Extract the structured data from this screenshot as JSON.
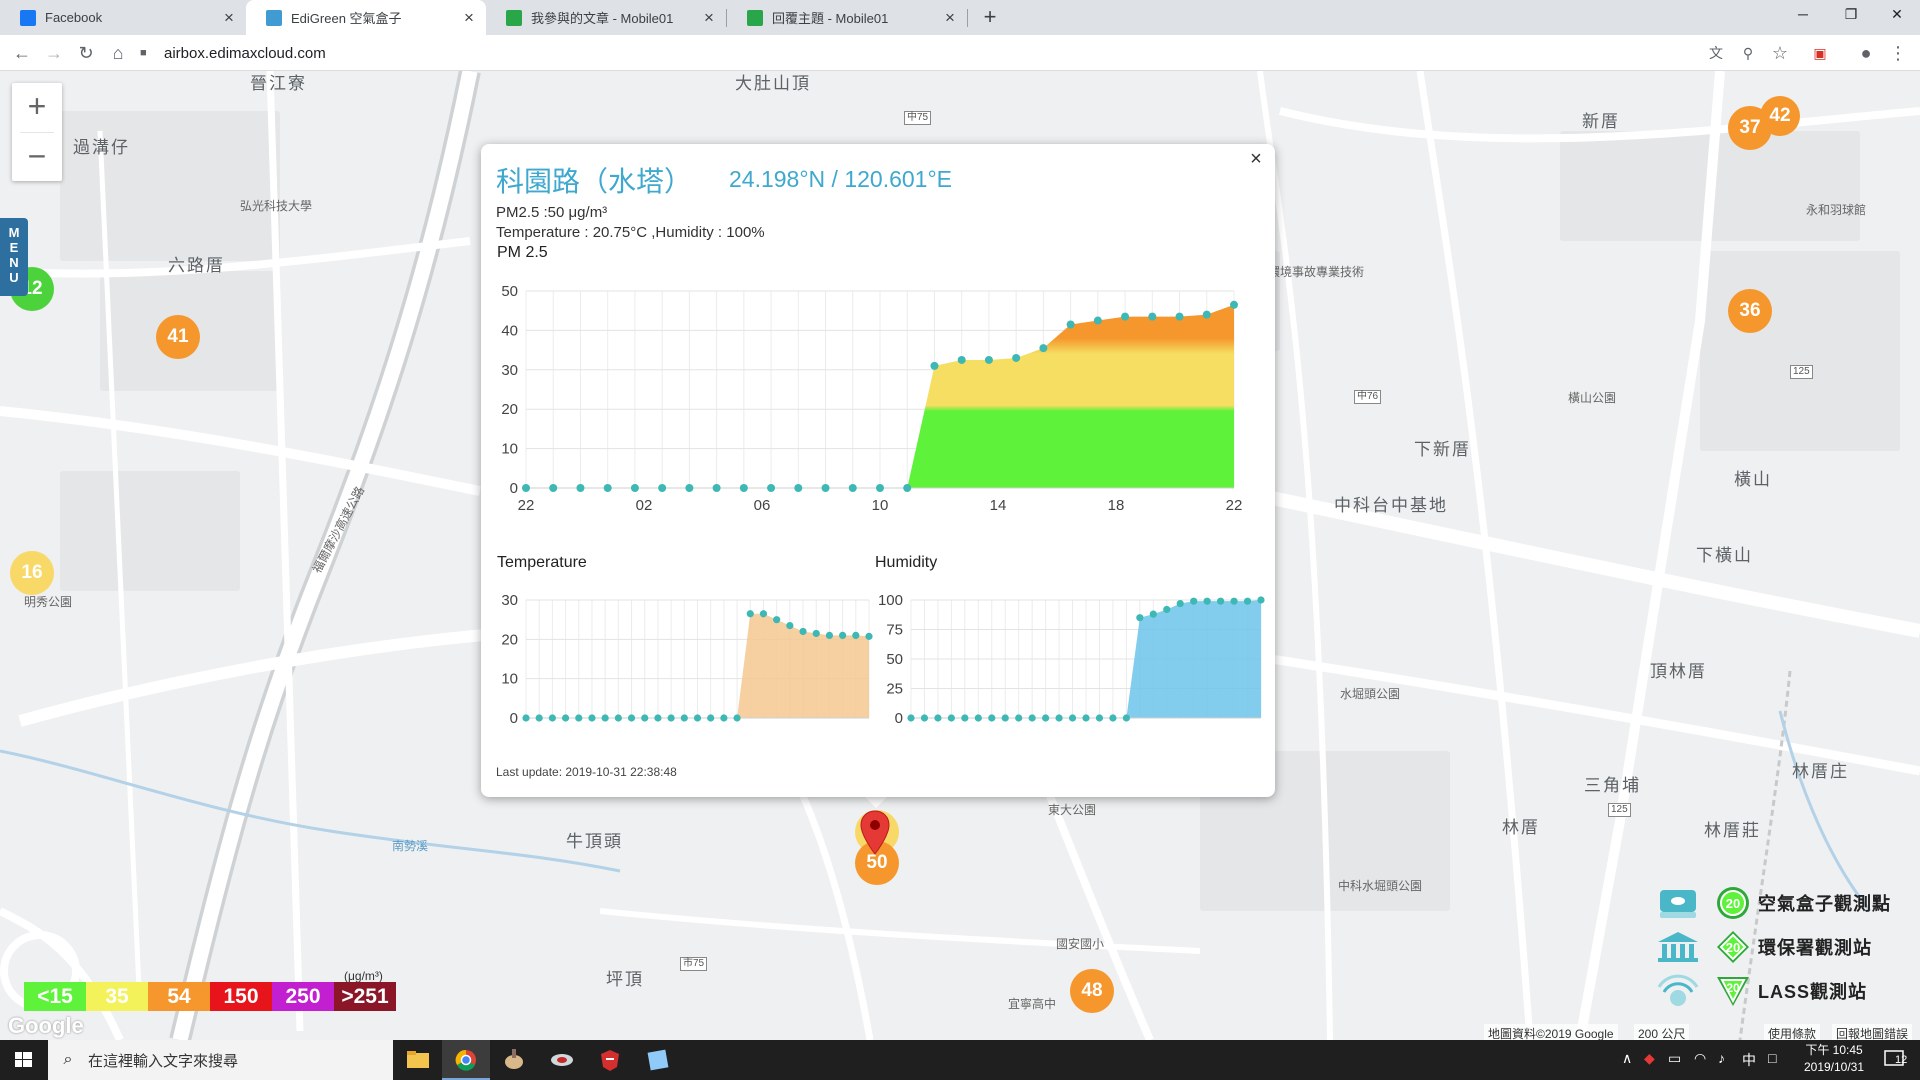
{
  "browser": {
    "tabs": [
      {
        "title": "Facebook",
        "favicon_color": "#1877f2",
        "active": false
      },
      {
        "title": "EdiGreen 空氣盒子",
        "favicon_color": "#3f9bd1",
        "active": true
      },
      {
        "title": "我參與的文章 - Mobile01",
        "favicon_color": "#2aa64a",
        "active": false
      },
      {
        "title": "回覆主題 - Mobile01",
        "favicon_color": "#2aa64a",
        "active": false
      }
    ],
    "new_tab": "+",
    "address": "airbox.edimaxcloud.com"
  },
  "map": {
    "zoom_in": "+",
    "zoom_out": "−",
    "menu_label": [
      "M",
      "E",
      "N",
      "U"
    ],
    "labels": {
      "l1": "晉江寮",
      "l2": "過溝仔",
      "l3": "大肚山頂",
      "l4": "新厝",
      "l5": "六路厝",
      "l6": "下新厝",
      "l7": "中科台中基地",
      "l8": "橫山",
      "l9": "下橫山",
      "l10": "頂林厝",
      "l11": "三角埔",
      "l12": "林厝",
      "l13": "林厝庄",
      "l14": "林厝莊",
      "l15": "牛頂頭",
      "l16": "坪頂",
      "l17": "東大公園",
      "l18": "明秀公園",
      "l19": "弘光科技大學",
      "l20": "台中環境事故專業技術小組",
      "l21": "橫山公園",
      "l22": "水堀頭公園",
      "l23": "中科水堀頭公園",
      "l24": "國安國小",
      "l25": "宜寧高中",
      "l26": "福爾摩沙高速公路",
      "l27": "南勢溪",
      "l28": "永和羽球館"
    },
    "markers": [
      {
        "value": "37"
      },
      {
        "value": "42"
      },
      {
        "value": "36"
      },
      {
        "value": "12"
      },
      {
        "value": "41"
      },
      {
        "value": "16"
      },
      {
        "value": "48"
      },
      {
        "value": "50"
      }
    ],
    "legend": {
      "unit": "(μg/m³)",
      "items": [
        {
          "label": "<15",
          "color": "#5ef23b"
        },
        {
          "label": "35",
          "color": "#f3f25b"
        },
        {
          "label": "54",
          "color": "#f5972c"
        },
        {
          "label": "150",
          "color": "#e8141c"
        },
        {
          "label": "250",
          "color": "#c21fd1"
        },
        {
          "label": ">251",
          "color": "#8a1628"
        }
      ]
    },
    "stations": [
      {
        "badge": "20",
        "label": "空氣盒子觀測點"
      },
      {
        "badge": "20",
        "label": "環保署觀測站"
      },
      {
        "badge": "20",
        "label": "LASS觀測站"
      }
    ],
    "google_logo": "Google",
    "attribution": {
      "data": "地圖資料©2019 Google",
      "scale": "200 公尺",
      "terms": "使用條款",
      "report": "回報地圖錯誤"
    }
  },
  "popup": {
    "title": "科園路（水塔）",
    "coords": "24.198°N / 120.601°E",
    "pm_line": "PM2.5 :50 μg/m³",
    "env_line": "Temperature : 20.75°C ,Humidity : 100%",
    "pm_heading": "PM 2.5",
    "temp_heading": "Temperature",
    "hum_heading": "Humidity",
    "last_update": "Last update: 2019-10-31 22:38:48",
    "close": "×"
  },
  "chart_data": [
    {
      "type": "area",
      "title": "PM 2.5",
      "xlabel": "",
      "ylabel": "",
      "x_tick_labels": [
        "22",
        "02",
        "06",
        "10",
        "14",
        "18",
        "22"
      ],
      "ylim": [
        0,
        50
      ],
      "yticks": [
        0,
        10,
        20,
        30,
        40,
        50
      ],
      "grid": true,
      "colors": {
        "green": "#5ef23b",
        "yellow": "#f6de62",
        "orange": "#f5972c",
        "marker": "#3db8b4"
      },
      "values": [
        0,
        0,
        0,
        0,
        0,
        0,
        0,
        0,
        0,
        0,
        0,
        0,
        0,
        0,
        0,
        31,
        32.5,
        32.5,
        33,
        35.5,
        41.5,
        42.5,
        43.5,
        43.5,
        43.5,
        44,
        46.5
      ]
    },
    {
      "type": "area",
      "title": "Temperature",
      "ylim": [
        0,
        30
      ],
      "yticks": [
        0,
        10,
        20,
        30
      ],
      "grid": true,
      "color": "#f5c88f",
      "values": [
        0,
        0,
        0,
        0,
        0,
        0,
        0,
        0,
        0,
        0,
        0,
        0,
        0,
        0,
        0,
        0,
        0,
        26.5,
        26.5,
        25,
        23.5,
        22,
        21.5,
        21,
        21,
        21,
        20.75
      ]
    },
    {
      "type": "area",
      "title": "Humidity",
      "ylim": [
        0,
        100
      ],
      "yticks": [
        0,
        25,
        50,
        75,
        100
      ],
      "grid": true,
      "color": "#6cc4ea",
      "values": [
        0,
        0,
        0,
        0,
        0,
        0,
        0,
        0,
        0,
        0,
        0,
        0,
        0,
        0,
        0,
        0,
        0,
        85,
        88,
        92,
        97,
        99,
        99,
        99,
        99,
        99,
        100
      ]
    }
  ],
  "taskbar": {
    "search_placeholder": "在這裡輸入文字來搜尋",
    "ime": "中",
    "time": "下午 10:45",
    "date": "2019/10/31",
    "notifications": "12"
  }
}
